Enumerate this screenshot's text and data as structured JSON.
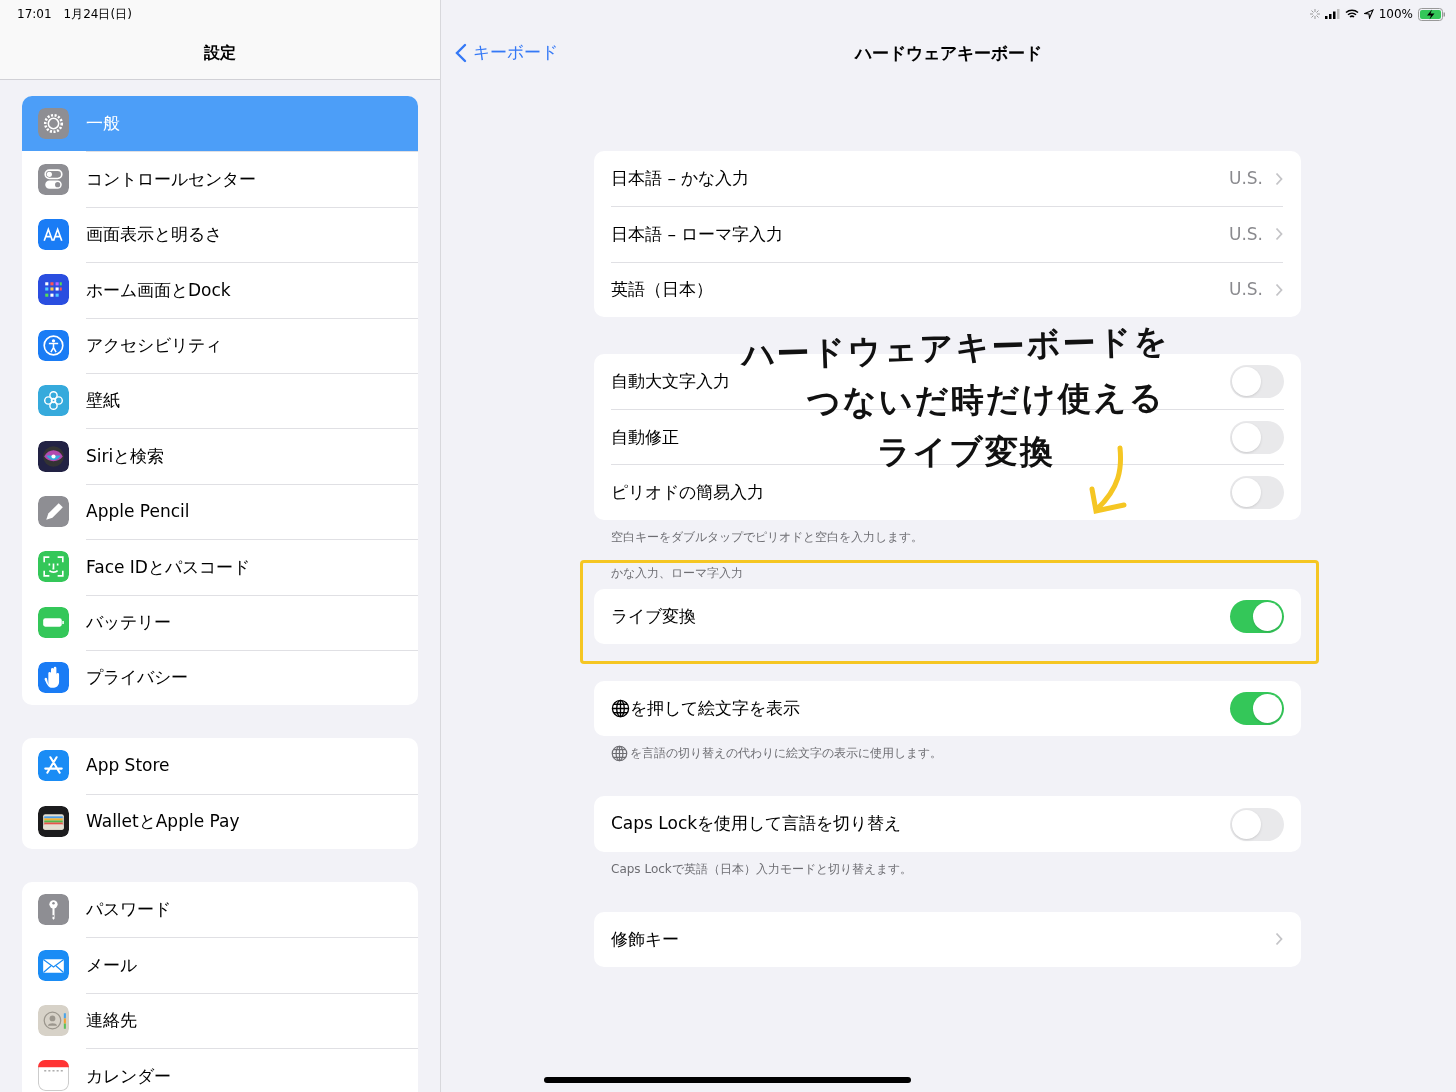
{
  "status_bar": {
    "time": "17:01",
    "date": "1月24日(日)",
    "battery": "100%"
  },
  "sidebar": {
    "title": "設定",
    "groups": [
      {
        "items": [
          {
            "label": "一般",
            "selected": true
          },
          {
            "label": "コントロールセンター",
            "selected": false
          },
          {
            "label": "画面表示と明るさ",
            "selected": false
          },
          {
            "label": "ホーム画面とDock",
            "selected": false
          },
          {
            "label": "アクセシビリティ",
            "selected": false
          },
          {
            "label": "壁紙",
            "selected": false
          },
          {
            "label": "Siriと検索",
            "selected": false
          },
          {
            "label": "Apple Pencil",
            "selected": false
          },
          {
            "label": "Face IDとパスコード",
            "selected": false
          },
          {
            "label": "バッテリー",
            "selected": false
          },
          {
            "label": "プライバシー",
            "selected": false
          }
        ]
      },
      {
        "items": [
          {
            "label": "App Store",
            "selected": false
          },
          {
            "label": "WalletとApple Pay",
            "selected": false
          }
        ]
      },
      {
        "items": [
          {
            "label": "パスワード",
            "selected": false
          },
          {
            "label": "メール",
            "selected": false
          },
          {
            "label": "連絡先",
            "selected": false
          },
          {
            "label": "カレンダー",
            "selected": false
          }
        ]
      }
    ]
  },
  "detail": {
    "back": "キーボード",
    "title": "ハードウェアキーボード",
    "groups": [
      {
        "rows": [
          {
            "kind": "value",
            "label": "日本語 – かな入力",
            "value": "U.S."
          },
          {
            "kind": "value",
            "label": "日本語 – ローマ字入力",
            "value": "U.S."
          },
          {
            "kind": "value",
            "label": "英語（日本）",
            "value": "U.S."
          }
        ]
      },
      {
        "rows": [
          {
            "kind": "toggle",
            "label": "自動大文字入力",
            "on": false
          },
          {
            "kind": "toggle",
            "label": "自動修正",
            "on": false
          },
          {
            "kind": "toggle",
            "label": "ピリオドの簡易入力",
            "on": false
          }
        ],
        "footer": "空白キーをダブルタップでピリオドと空白を入力します。"
      },
      {
        "header": "かな入力、ローマ字入力",
        "highlighted": true,
        "rows": [
          {
            "kind": "toggle",
            "label": "ライブ変換",
            "on": true
          }
        ]
      },
      {
        "rows": [
          {
            "kind": "toggle",
            "label": "を押して絵文字を表示",
            "globe": true,
            "on": true
          }
        ],
        "footer": "を言語の切り替えの代わりに絵文字の表示に使用します。",
        "footer_globe": true
      },
      {
        "rows": [
          {
            "kind": "toggle",
            "label": "Caps Lockを使用して言語を切り替え",
            "on": false
          }
        ],
        "footer": "Caps Lockで英語（日本）入力モードと切り替えます。"
      },
      {
        "rows": [
          {
            "kind": "link",
            "label": "修飾キー"
          }
        ]
      }
    ]
  },
  "annotation": {
    "lines": [
      "ハードウェアキーボードを",
      "つないだ時だけ使える",
      "ライブ変換"
    ]
  }
}
